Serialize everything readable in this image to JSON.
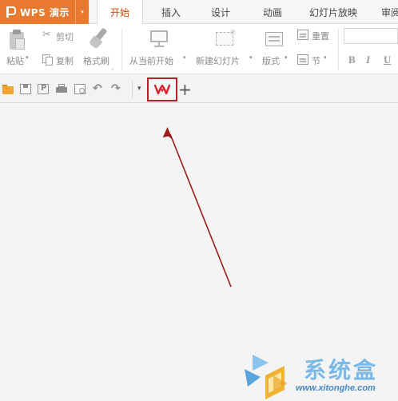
{
  "app": {
    "title": "WPS 演示",
    "menu_caret": "▾"
  },
  "tabs": [
    {
      "label": "开始",
      "active": true
    },
    {
      "label": "插入",
      "active": false
    },
    {
      "label": "设计",
      "active": false
    },
    {
      "label": "动画",
      "active": false
    },
    {
      "label": "幻灯片放映",
      "active": false
    },
    {
      "label": "审阅",
      "active": false
    }
  ],
  "ribbon": {
    "paste_label": "粘贴",
    "cut_label": "剪切",
    "copy_label": "复制",
    "format_painter_label": "格式刷",
    "from_current_label": "从当前开始",
    "new_slide_label": "新建幻灯片",
    "layout_label": "版式",
    "reset_label": "重置",
    "section_label": "节",
    "bold_label": "B",
    "italic_label": "I",
    "underline_label": "U",
    "dropdown_caret": "▾",
    "font_name_value": ""
  },
  "quick_access": {
    "icons": [
      "open-folder-icon",
      "save-icon",
      "export-pdf-icon",
      "print-icon",
      "print-preview-icon",
      "undo-icon",
      "redo-icon"
    ],
    "undo_glyph": "↶",
    "redo_glyph": "↷",
    "customize_glyph": "▾",
    "new_tab_glyph": "+"
  },
  "highlight": {
    "target": "wps-document-tab",
    "box_color": "#b8232a",
    "arrow_color": "#9e1b1b"
  },
  "watermark": {
    "text": "系统盒",
    "url": "www.xitonghe.com"
  },
  "colors": {
    "app_button": "#e8792e",
    "active_tab_text": "#d04a02",
    "wps_logo": "#d6262f"
  }
}
